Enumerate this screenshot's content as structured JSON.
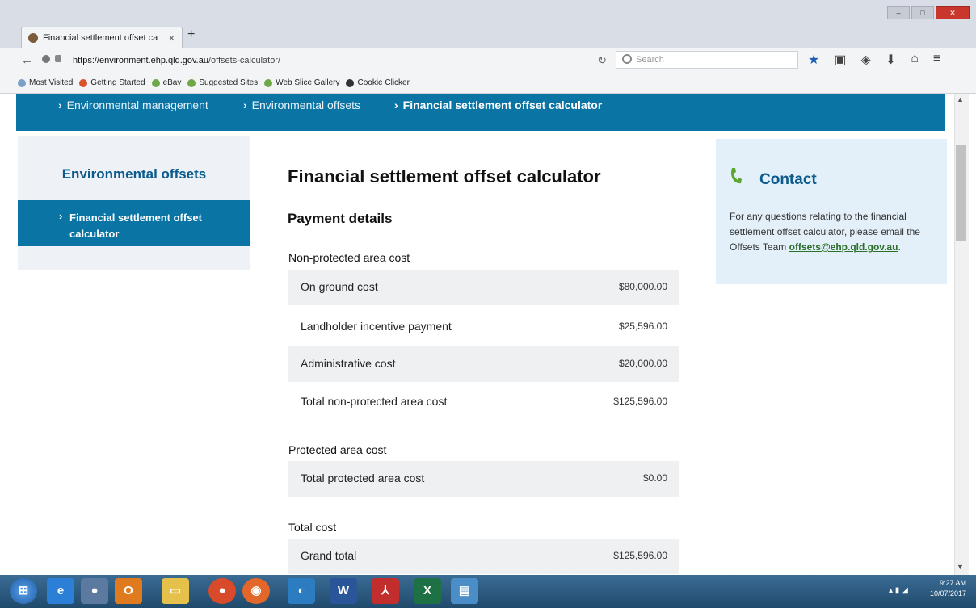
{
  "browser": {
    "tab_title": "Financial settlement offset ca",
    "url_host": "https://environment.ehp.qld.gov.au",
    "url_path": "/offsets-calculator/",
    "search_placeholder": "Search",
    "bookmarks": [
      "Most Visited",
      "Getting Started",
      "eBay",
      "Suggested Sites",
      "Web Slice Gallery",
      "Cookie Clicker"
    ]
  },
  "breadcrumb": [
    "Environmental management",
    "Environmental offsets",
    "Financial settlement offset calculator"
  ],
  "sidebar": {
    "title": "Environmental offsets",
    "item": "Financial settlement offset calculator"
  },
  "main": {
    "title": "Financial settlement offset calculator",
    "section": "Payment details",
    "non_protected": {
      "heading": "Non-protected area cost",
      "rows": [
        {
          "label": "On ground cost",
          "value": "$80,000.00"
        },
        {
          "label": "Landholder incentive payment",
          "value": "$25,596.00"
        },
        {
          "label": "Administrative cost",
          "value": "$20,000.00"
        },
        {
          "label": "Total non-protected area cost",
          "value": "$125,596.00"
        }
      ]
    },
    "protected": {
      "heading": "Protected area cost",
      "rows": [
        {
          "label": "Total protected area cost",
          "value": "$0.00"
        }
      ]
    },
    "total": {
      "heading": "Total cost",
      "rows": [
        {
          "label": "Grand total",
          "value": "$125,596.00"
        }
      ]
    }
  },
  "contact": {
    "title": "Contact",
    "text": "For any questions relating to the financial settlement offset calculator, please email the Offsets Team",
    "email": "offsets@ehp.qld.gov.au",
    "end": "."
  },
  "taskbar": {
    "time": "9:27 AM",
    "date": "10/07/2017",
    "word_label": "W",
    "excel_label": "X"
  },
  "colors": {
    "brand_blue": "#0a74a5",
    "heading_blue": "#0b5b8c",
    "contact_bg": "#e4f0f9"
  }
}
